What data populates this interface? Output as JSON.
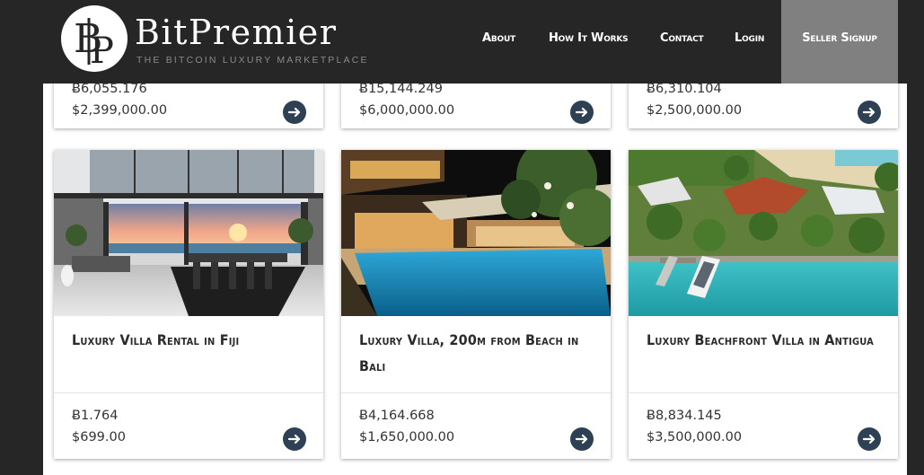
{
  "header": {
    "brand_name": "BitPremier",
    "brand_tagline": "THE BITCOIN LUXURY MARKETPLACE",
    "nav": [
      {
        "label": "About"
      },
      {
        "label": "How It Works"
      },
      {
        "label": "Contact"
      },
      {
        "label": "Login"
      }
    ],
    "signup_label": "Seller Signup",
    "colors": {
      "header_bg": "#262626",
      "signup_bg": "#808080",
      "arrow_button": "#2e4053"
    }
  },
  "top_row": [
    {
      "btc": "Ƀ6,055.176",
      "usd": "$2,399,000.00"
    },
    {
      "btc": "Ƀ15,144.249",
      "usd": "$6,000,000.00"
    },
    {
      "btc": "Ƀ6,310.104",
      "usd": "$2,500,000.00"
    }
  ],
  "listings": [
    {
      "title": "Luxury Villa Rental in Fiji",
      "btc": "Ƀ1.764",
      "usd": "$699.00",
      "photo": "modern-villa-interior-sunset"
    },
    {
      "title": "Luxury Villa, 200m from Beach in Bali",
      "btc": "Ƀ4,164.668",
      "usd": "$1,650,000.00",
      "photo": "villa-pool-night"
    },
    {
      "title": "Luxury Beachfront Villa in Antigua",
      "btc": "Ƀ8,834.145",
      "usd": "$3,500,000.00",
      "photo": "aerial-beachfront-villa"
    }
  ]
}
